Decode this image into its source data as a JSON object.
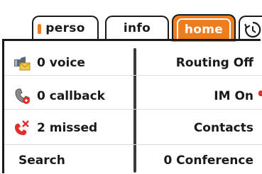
{
  "tabs": [
    {
      "label": "perso",
      "active": false
    },
    {
      "label": "info",
      "active": false
    },
    {
      "label": "home",
      "active": true
    }
  ],
  "tab_extra_icon": "history-icon",
  "left_items": [
    {
      "label": "0 voice",
      "icon": "voicemail-icon"
    },
    {
      "label": "0 callback",
      "icon": "callback-icon"
    },
    {
      "label": "2 missed",
      "icon": "missed-call-icon"
    },
    {
      "label": "Search",
      "icon": ""
    }
  ],
  "right_items": [
    {
      "label": "Routing Off"
    },
    {
      "label": "IM On"
    },
    {
      "label": "Contacts"
    },
    {
      "label": "0 Conference"
    }
  ],
  "colors": {
    "accent": "#ee7d1f",
    "text": "#1a1a1a",
    "missed": "#e0302a"
  }
}
